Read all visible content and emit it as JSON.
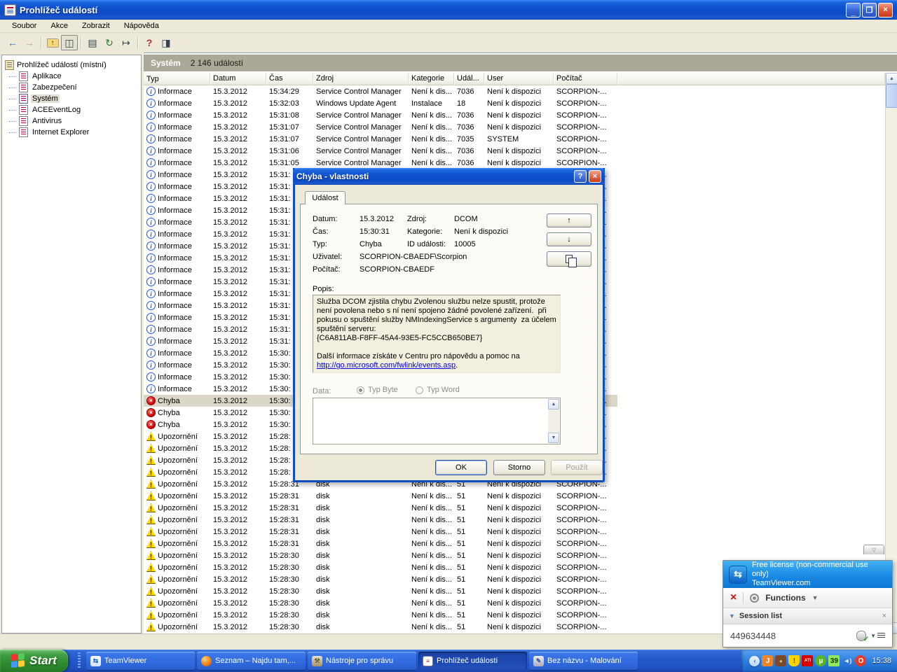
{
  "window": {
    "title": "Prohlížeč událostí",
    "menu": [
      "Soubor",
      "Akce",
      "Zobrazit",
      "Nápověda"
    ],
    "titlebar_buttons": {
      "minimize": "_",
      "restore": "❐",
      "close": "×"
    }
  },
  "toolbar": {
    "buttons": [
      {
        "name": "back-icon",
        "glyph": "←",
        "cls": "g-blue"
      },
      {
        "name": "forward-icon",
        "glyph": "→",
        "cls": "g-gray"
      },
      {
        "sep": true
      },
      {
        "name": "up-folder-icon",
        "glyph": "↑",
        "cls": "g-folder"
      },
      {
        "name": "show-tree-icon",
        "glyph": "◫",
        "cls": "g-doc",
        "pressed": true
      },
      {
        "sep": true
      },
      {
        "name": "properties-icon",
        "glyph": "▤",
        "cls": "g-doc"
      },
      {
        "name": "refresh-icon",
        "glyph": "↻",
        "cls": "g-green"
      },
      {
        "name": "export-list-icon",
        "glyph": "↦",
        "cls": "g-doc"
      },
      {
        "sep": true
      },
      {
        "name": "help-icon",
        "glyph": "?",
        "cls": "g-help"
      },
      {
        "name": "show-panel-icon",
        "glyph": "◨",
        "cls": "g-doc"
      }
    ]
  },
  "sidebar": {
    "root": "Prohlížeč událostí (místní)",
    "items": [
      {
        "label": "Aplikace",
        "selected": false
      },
      {
        "label": "Zabezpečení",
        "selected": false
      },
      {
        "label": "Systém",
        "selected": true
      },
      {
        "label": "ACEEventLog",
        "selected": false
      },
      {
        "label": "Antivirus",
        "selected": false
      },
      {
        "label": "Internet Explorer",
        "selected": false
      }
    ]
  },
  "list": {
    "header_title": "Systém",
    "header_count": "2 146 událostí",
    "columns": [
      "Typ",
      "Datum",
      "Čas",
      "Zdroj",
      "Kategorie",
      "Udál...",
      "User",
      "Počítač"
    ],
    "rows": [
      {
        "t": "info",
        "l": "Informace",
        "d": "15.3.2012",
        "c": "15:34:29",
        "z": "Service Control Manager",
        "k": "Není k dis...",
        "e": "7036",
        "u": "Není k dispozici",
        "p": "SCORPION-..."
      },
      {
        "t": "info",
        "l": "Informace",
        "d": "15.3.2012",
        "c": "15:32:03",
        "z": "Windows Update Agent",
        "k": "Instalace",
        "e": "18",
        "u": "Není k dispozici",
        "p": "SCORPION-..."
      },
      {
        "t": "info",
        "l": "Informace",
        "d": "15.3.2012",
        "c": "15:31:08",
        "z": "Service Control Manager",
        "k": "Není k dis...",
        "e": "7036",
        "u": "Není k dispozici",
        "p": "SCORPION-..."
      },
      {
        "t": "info",
        "l": "Informace",
        "d": "15.3.2012",
        "c": "15:31:07",
        "z": "Service Control Manager",
        "k": "Není k dis...",
        "e": "7036",
        "u": "Není k dispozici",
        "p": "SCORPION-..."
      },
      {
        "t": "info",
        "l": "Informace",
        "d": "15.3.2012",
        "c": "15:31:07",
        "z": "Service Control Manager",
        "k": "Není k dis...",
        "e": "7035",
        "u": "SYSTEM",
        "p": "SCORPION-..."
      },
      {
        "t": "info",
        "l": "Informace",
        "d": "15.3.2012",
        "c": "15:31:06",
        "z": "Service Control Manager",
        "k": "Není k dis...",
        "e": "7036",
        "u": "Není k dispozici",
        "p": "SCORPION-..."
      },
      {
        "t": "info",
        "l": "Informace",
        "d": "15.3.2012",
        "c": "15:31:05",
        "z": "Service Control Manager",
        "k": "Není k dis...",
        "e": "7036",
        "u": "Není k dispozici",
        "p": "SCORPION-..."
      },
      {
        "t": "info",
        "l": "Informace",
        "d": "15.3.2012",
        "c": "15:31:",
        "z": "",
        "k": "",
        "e": "",
        "u": "",
        "p": "SCORPION-..."
      },
      {
        "t": "info",
        "l": "Informace",
        "d": "15.3.2012",
        "c": "15:31:",
        "z": "",
        "k": "",
        "e": "",
        "u": "",
        "p": "SCORPION-..."
      },
      {
        "t": "info",
        "l": "Informace",
        "d": "15.3.2012",
        "c": "15:31:",
        "z": "",
        "k": "",
        "e": "",
        "u": "",
        "p": "SCORPION-..."
      },
      {
        "t": "info",
        "l": "Informace",
        "d": "15.3.2012",
        "c": "15:31:",
        "z": "",
        "k": "",
        "e": "",
        "u": "",
        "p": "SCORPION-..."
      },
      {
        "t": "info",
        "l": "Informace",
        "d": "15.3.2012",
        "c": "15:31:",
        "z": "",
        "k": "",
        "e": "",
        "u": "",
        "p": "SCORPION-..."
      },
      {
        "t": "info",
        "l": "Informace",
        "d": "15.3.2012",
        "c": "15:31:",
        "z": "",
        "k": "",
        "e": "",
        "u": "",
        "p": "SCORPION-..."
      },
      {
        "t": "info",
        "l": "Informace",
        "d": "15.3.2012",
        "c": "15:31:",
        "z": "",
        "k": "",
        "e": "",
        "u": "",
        "p": "SCORPION-..."
      },
      {
        "t": "info",
        "l": "Informace",
        "d": "15.3.2012",
        "c": "15:31:",
        "z": "",
        "k": "",
        "e": "",
        "u": "",
        "p": "SCORPION-..."
      },
      {
        "t": "info",
        "l": "Informace",
        "d": "15.3.2012",
        "c": "15:31:",
        "z": "",
        "k": "",
        "e": "",
        "u": "",
        "p": "SCORPION-..."
      },
      {
        "t": "info",
        "l": "Informace",
        "d": "15.3.2012",
        "c": "15:31:",
        "z": "",
        "k": "",
        "e": "",
        "u": "",
        "p": "SCORPION-..."
      },
      {
        "t": "info",
        "l": "Informace",
        "d": "15.3.2012",
        "c": "15:31:",
        "z": "",
        "k": "",
        "e": "",
        "u": "",
        "p": "SCORPION-..."
      },
      {
        "t": "info",
        "l": "Informace",
        "d": "15.3.2012",
        "c": "15:31:",
        "z": "",
        "k": "",
        "e": "",
        "u": "",
        "p": "SCORPION-..."
      },
      {
        "t": "info",
        "l": "Informace",
        "d": "15.3.2012",
        "c": "15:31:",
        "z": "",
        "k": "",
        "e": "",
        "u": "",
        "p": "SCORPION-..."
      },
      {
        "t": "info",
        "l": "Informace",
        "d": "15.3.2012",
        "c": "15:31:",
        "z": "",
        "k": "",
        "e": "",
        "u": "",
        "p": "SCORPION-..."
      },
      {
        "t": "info",
        "l": "Informace",
        "d": "15.3.2012",
        "c": "15:31:",
        "z": "",
        "k": "",
        "e": "",
        "u": "",
        "p": "SCORPION-..."
      },
      {
        "t": "info",
        "l": "Informace",
        "d": "15.3.2012",
        "c": "15:30:",
        "z": "",
        "k": "",
        "e": "",
        "u": "",
        "p": "SCORPION-..."
      },
      {
        "t": "info",
        "l": "Informace",
        "d": "15.3.2012",
        "c": "15:30:",
        "z": "",
        "k": "",
        "e": "",
        "u": "",
        "p": "SCORPION-..."
      },
      {
        "t": "info",
        "l": "Informace",
        "d": "15.3.2012",
        "c": "15:30:",
        "z": "",
        "k": "",
        "e": "",
        "u": "",
        "p": "SCORPION-..."
      },
      {
        "t": "info",
        "l": "Informace",
        "d": "15.3.2012",
        "c": "15:30:",
        "z": "",
        "k": "",
        "e": "",
        "u": "",
        "p": "SCORPION-..."
      },
      {
        "t": "err",
        "l": "Chyba",
        "d": "15.3.2012",
        "c": "15:30:",
        "z": "",
        "k": "",
        "e": "",
        "u": "",
        "p": "SCORPION-...",
        "sel": true
      },
      {
        "t": "err",
        "l": "Chyba",
        "d": "15.3.2012",
        "c": "15:30:",
        "z": "",
        "k": "",
        "e": "",
        "u": "",
        "p": "SCORPION-..."
      },
      {
        "t": "err",
        "l": "Chyba",
        "d": "15.3.2012",
        "c": "15:30:",
        "z": "",
        "k": "",
        "e": "",
        "u": "",
        "p": "SCORPION-..."
      },
      {
        "t": "warn",
        "l": "Upozornění",
        "d": "15.3.2012",
        "c": "15:28:",
        "z": "",
        "k": "",
        "e": "",
        "u": "",
        "p": "SCORPION-..."
      },
      {
        "t": "warn",
        "l": "Upozornění",
        "d": "15.3.2012",
        "c": "15:28:",
        "z": "",
        "k": "",
        "e": "",
        "u": "",
        "p": "SCORPION-..."
      },
      {
        "t": "warn",
        "l": "Upozornění",
        "d": "15.3.2012",
        "c": "15:28:",
        "z": "",
        "k": "",
        "e": "",
        "u": "",
        "p": "SCORPION-..."
      },
      {
        "t": "warn",
        "l": "Upozornění",
        "d": "15.3.2012",
        "c": "15:28:",
        "z": "",
        "k": "",
        "e": "",
        "u": "",
        "p": "SCORPION-..."
      },
      {
        "t": "warn",
        "l": "Upozornění",
        "d": "15.3.2012",
        "c": "15:28:31",
        "z": "disk",
        "k": "Není k dis...",
        "e": "51",
        "u": "Není k dispozici",
        "p": "SCORPION-..."
      },
      {
        "t": "warn",
        "l": "Upozornění",
        "d": "15.3.2012",
        "c": "15:28:31",
        "z": "disk",
        "k": "Není k dis...",
        "e": "51",
        "u": "Není k dispozici",
        "p": "SCORPION-..."
      },
      {
        "t": "warn",
        "l": "Upozornění",
        "d": "15.3.2012",
        "c": "15:28:31",
        "z": "disk",
        "k": "Není k dis...",
        "e": "51",
        "u": "Není k dispozici",
        "p": "SCORPION-..."
      },
      {
        "t": "warn",
        "l": "Upozornění",
        "d": "15.3.2012",
        "c": "15:28:31",
        "z": "disk",
        "k": "Není k dis...",
        "e": "51",
        "u": "Není k dispozici",
        "p": "SCORPION-..."
      },
      {
        "t": "warn",
        "l": "Upozornění",
        "d": "15.3.2012",
        "c": "15:28:31",
        "z": "disk",
        "k": "Není k dis...",
        "e": "51",
        "u": "Není k dispozici",
        "p": "SCORPION-..."
      },
      {
        "t": "warn",
        "l": "Upozornění",
        "d": "15.3.2012",
        "c": "15:28:31",
        "z": "disk",
        "k": "Není k dis...",
        "e": "51",
        "u": "Není k dispozici",
        "p": "SCORPION-..."
      },
      {
        "t": "warn",
        "l": "Upozornění",
        "d": "15.3.2012",
        "c": "15:28:30",
        "z": "disk",
        "k": "Není k dis...",
        "e": "51",
        "u": "Není k dispozici",
        "p": "SCORPION-..."
      },
      {
        "t": "warn",
        "l": "Upozornění",
        "d": "15.3.2012",
        "c": "15:28:30",
        "z": "disk",
        "k": "Není k dis...",
        "e": "51",
        "u": "Není k dispozici",
        "p": "SCORPION-..."
      },
      {
        "t": "warn",
        "l": "Upozornění",
        "d": "15.3.2012",
        "c": "15:28:30",
        "z": "disk",
        "k": "Není k dis...",
        "e": "51",
        "u": "Není k dispozici",
        "p": "SCORPION-..."
      },
      {
        "t": "warn",
        "l": "Upozornění",
        "d": "15.3.2012",
        "c": "15:28:30",
        "z": "disk",
        "k": "Není k dis...",
        "e": "51",
        "u": "Není k dispozici",
        "p": "SCORPION-..."
      },
      {
        "t": "warn",
        "l": "Upozornění",
        "d": "15.3.2012",
        "c": "15:28:30",
        "z": "disk",
        "k": "Není k dis...",
        "e": "51",
        "u": "Není k dispozici",
        "p": "SCORPION-..."
      },
      {
        "t": "warn",
        "l": "Upozornění",
        "d": "15.3.2012",
        "c": "15:28:30",
        "z": "disk",
        "k": "Není k dis...",
        "e": "51",
        "u": "Není k dispozici",
        "p": "SCORPION-..."
      },
      {
        "t": "warn",
        "l": "Upozornění",
        "d": "15.3.2012",
        "c": "15:28:30",
        "z": "disk",
        "k": "Není k dis...",
        "e": "51",
        "u": "Není k dispozici",
        "p": "SCORPION-..."
      }
    ]
  },
  "dialog": {
    "title": "Chyba - vlastnosti",
    "tab": "Událost",
    "datum_label": "Datum:",
    "datum": "15.3.2012",
    "zdroj_label": "Zdroj:",
    "zdroj": "DCOM",
    "cas_label": "Čas:",
    "cas": "15:30:31",
    "kategorie_label": "Kategorie:",
    "kategorie": "Není k dispozici",
    "typ_label": "Typ:",
    "typ": "Chyba",
    "id_label": "ID události:",
    "id": "10005",
    "uzivatel_label": "Uživatel:",
    "uzivatel": "SCORPION-CBAEDF\\Scorpion",
    "pocitac_label": "Počítač:",
    "pocitac": "SCORPION-CBAEDF",
    "popis_label": "Popis:",
    "description": "Služba DCOM zjistila chybu Zvolenou službu nelze spustit, protože není povolena nebo s ní není spojeno žádné povolené zařízení.  při pokusu o spuštění služby NMIndexingService s argumenty  za účelem spuštění serveru:\n{C6A811AB-F8FF-45A4-93E5-FC5CCB650BE7}\n\nDalší informace získáte v Centru pro nápovědu a pomoc na",
    "link": "http://go.microsoft.com/fwlink/events.asp",
    "link_suffix": ".",
    "data_label": "Data:",
    "radio_byte": "Typ Byte",
    "radio_word": "Typ Word",
    "ok": "OK",
    "storno": "Storno",
    "pouzit": "Použít"
  },
  "teamviewer": {
    "license_line1": "Free license (non-commercial use only)",
    "license_line2": "TeamViewer.com",
    "functions": "Functions",
    "session_header": "Session list",
    "session_id": "449634448",
    "accent": "#1b8ae4"
  },
  "taskbar": {
    "start": "Start",
    "tasks": [
      {
        "name": "task-teamviewer",
        "label": "TeamViewer",
        "icon": "tv-ic",
        "glyph": "⇆",
        "active": false
      },
      {
        "name": "task-seznam",
        "label": "Seznam – Najdu tam,...",
        "icon": "ff-ic",
        "glyph": "",
        "active": false
      },
      {
        "name": "task-nastroje",
        "label": "Nástroje pro správu",
        "icon": "adm-ic",
        "glyph": "⚒",
        "active": false
      },
      {
        "name": "task-event-viewer",
        "label": "Prohlížeč událostí",
        "icon": "ev-ic",
        "glyph": "≡",
        "active": true
      },
      {
        "name": "task-malovani",
        "label": "Bez názvu - Malování",
        "icon": "mp-ic",
        "glyph": "✎",
        "active": false
      }
    ],
    "tray": [
      {
        "name": "java-icon",
        "glyph": "J",
        "bg": "#e8862b",
        "fg": "#fff",
        "round": "3px",
        "fs": "10px"
      },
      {
        "name": "app-brown-icon",
        "glyph": "●",
        "bg": "#7a4a2b",
        "fg": "#d8b890",
        "round": "3px",
        "fs": "8px"
      },
      {
        "name": "security-shield-icon",
        "glyph": "!",
        "bg": "#ffd200",
        "fg": "#7a3d00",
        "round": "2px 2px 7px 7px",
        "fs": "10px"
      },
      {
        "name": "ati-icon",
        "glyph": "ATI",
        "bg": "#d40000",
        "fg": "#fff",
        "round": "2px",
        "fs": "6px"
      },
      {
        "name": "utorrent-icon",
        "glyph": "µ",
        "bg": "#57b526",
        "fg": "#fff",
        "round": "50%",
        "fs": "10px"
      },
      {
        "name": "count-badge",
        "glyph": "39",
        "bg": "#90e85c",
        "fg": "#143000",
        "round": "2px",
        "fs": "10px"
      },
      {
        "name": "volume-icon",
        "glyph": "◄)",
        "bg": "transparent",
        "fg": "#e8eefc",
        "round": "0",
        "fs": "9px"
      },
      {
        "name": "opera-icon",
        "glyph": "O",
        "bg": "#e43a2a",
        "fg": "#fff",
        "round": "50%",
        "fs": "10px"
      }
    ],
    "clock": "15:38"
  }
}
